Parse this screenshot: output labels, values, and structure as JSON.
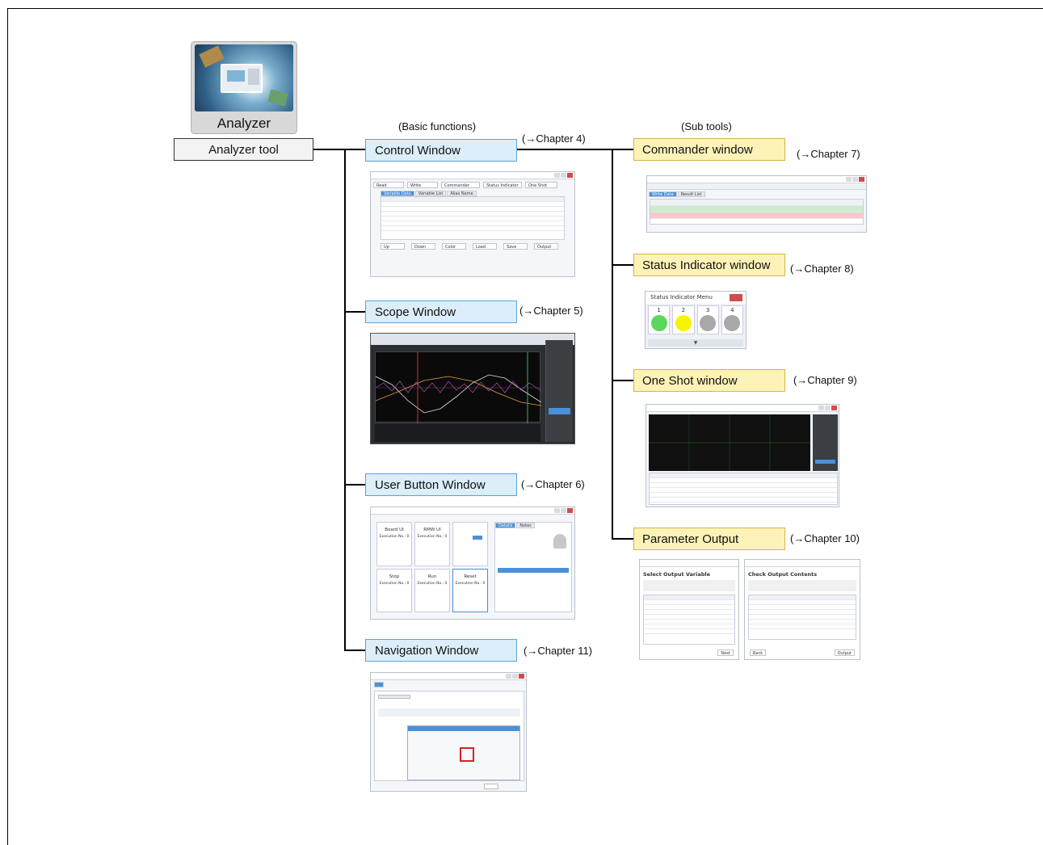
{
  "app_icon": {
    "label": "Analyzer"
  },
  "root": {
    "label": "Analyzer tool"
  },
  "headers": {
    "basic": "(Basic functions)",
    "sub": "(Sub tools)"
  },
  "basic": [
    {
      "label": "Control Window",
      "chapter": "(→Chapter 4)"
    },
    {
      "label": "Scope Window",
      "chapter": "(→Chapter 5)"
    },
    {
      "label": "User Button Window",
      "chapter": "(→Chapter 6)"
    },
    {
      "label": "Navigation Window",
      "chapter": "(→Chapter 11)"
    }
  ],
  "sub": [
    {
      "label": "Commander window",
      "chapter": "(→Chapter 7)"
    },
    {
      "label": "Status Indicator window",
      "chapter": "(→Chapter 8)"
    },
    {
      "label": "One Shot window",
      "chapter": "(→Chapter 9)"
    },
    {
      "label": "Parameter Output",
      "chapter": "(→Chapter 10)"
    }
  ],
  "status_indicator": {
    "title": "Status Indicator Menu",
    "slots": [
      {
        "num": "1",
        "color": "#5cd65c"
      },
      {
        "num": "2",
        "color": "#f5f500"
      },
      {
        "num": "3",
        "color": "#a8a8a8"
      },
      {
        "num": "4",
        "color": "#a8a8a8"
      }
    ]
  },
  "control_window": {
    "toolbar": [
      "Read",
      "Write",
      "Commander",
      "Status Indicator",
      "One Shot"
    ],
    "tabs": [
      "Variable Data",
      "Variable List",
      "Alias Name"
    ],
    "footer_buttons": [
      "Up",
      "Down",
      "Color",
      "Load",
      "Save",
      "Output"
    ]
  },
  "user_button": {
    "cells": [
      {
        "name": "Board UI",
        "exec": "Execution No.: 0"
      },
      {
        "name": "RMW UI",
        "exec": "Execution No.: 0"
      },
      {
        "name": "Stop",
        "exec": "Execution No.: 0"
      },
      {
        "name": "Run",
        "exec": "Execution No.: 0"
      },
      {
        "name": "Reset",
        "exec": "Execution No.: 0"
      }
    ],
    "tabs": [
      "Details",
      "Notes"
    ]
  },
  "parameter_output": {
    "left_title": "Select Output Variable",
    "right_title": "Check Output Contents",
    "next": "Next",
    "back": "Back",
    "output": "Output"
  },
  "commander": {
    "tabs": [
      "Write Data",
      "Result List"
    ]
  },
  "colors": {
    "blue_fill": "#dbeefa",
    "blue_border": "#5aa3d6",
    "yellow_fill": "#fdf2b8",
    "yellow_border": "#d4b64c"
  }
}
